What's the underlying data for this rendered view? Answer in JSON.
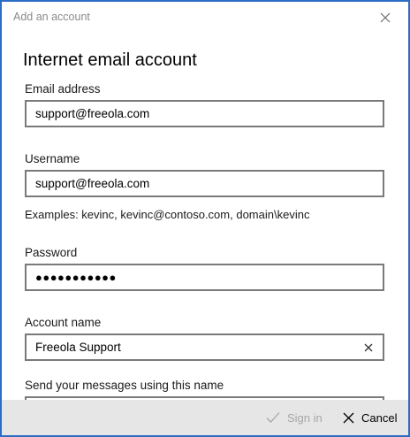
{
  "window": {
    "title": "Add an account",
    "heading": "Internet email account"
  },
  "form": {
    "email_label": "Email address",
    "email_value": "support@freeola.com",
    "username_label": "Username",
    "username_value": "support@freeola.com",
    "username_hint": "Examples: kevinc, kevinc@contoso.com, domain\\kevinc",
    "password_label": "Password",
    "password_value": "●●●●●●●●●●●",
    "account_name_label": "Account name",
    "account_name_value": "Freeola Support",
    "display_name_label": "Send your messages using this name"
  },
  "footer": {
    "signin_label": "Sign in",
    "cancel_label": "Cancel"
  },
  "colors": {
    "window_border": "#2b6cc4",
    "footer_bg": "#e6e6e6",
    "field_border": "#7a7a7a",
    "disabled_text": "#a7a7a7"
  },
  "icons": {
    "close": "close-icon",
    "clear": "clear-icon",
    "signin": "checkmark-icon",
    "cancel": "cancel-x-icon"
  }
}
